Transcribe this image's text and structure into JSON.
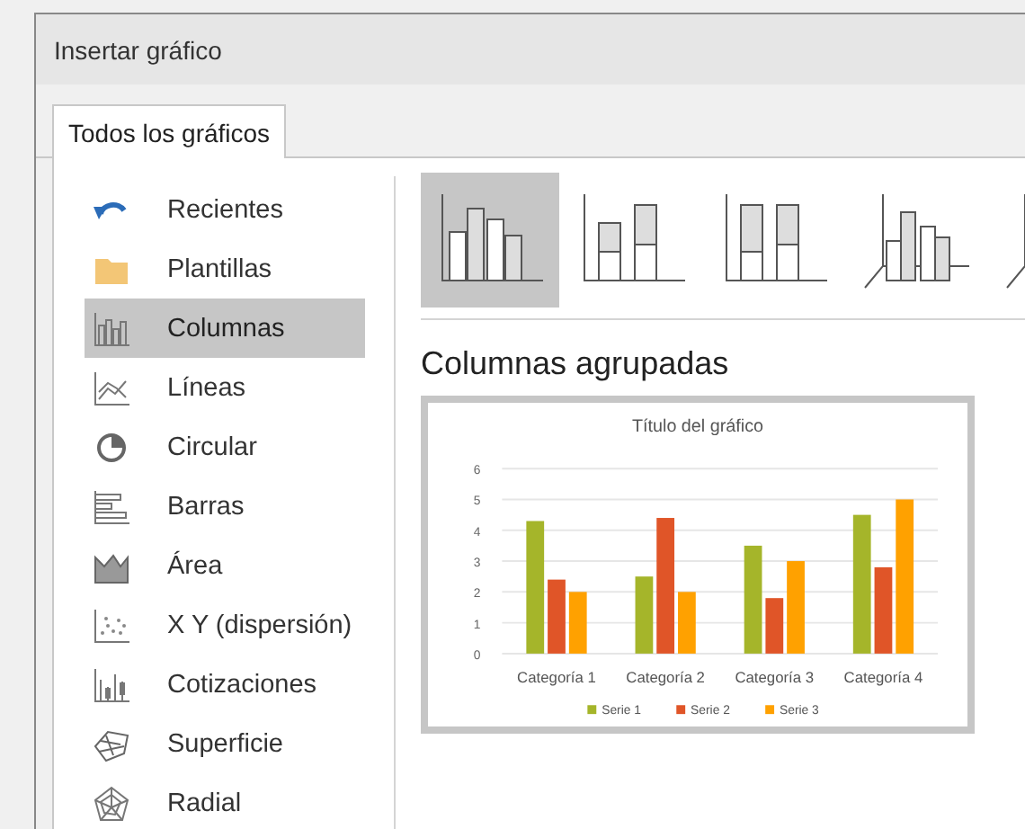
{
  "window": {
    "title": "Insertar gráfico"
  },
  "tabs": [
    {
      "label": "Todos los gráficos",
      "selected": true
    }
  ],
  "sidebar": {
    "items": [
      {
        "label": "Recientes",
        "selected": false
      },
      {
        "label": "Plantillas",
        "selected": false
      },
      {
        "label": "Columnas",
        "selected": true
      },
      {
        "label": "Líneas",
        "selected": false
      },
      {
        "label": "Circular",
        "selected": false
      },
      {
        "label": "Barras",
        "selected": false
      },
      {
        "label": "Área",
        "selected": false
      },
      {
        "label": "X Y (dispersión)",
        "selected": false
      },
      {
        "label": "Cotizaciones",
        "selected": false
      },
      {
        "label": "Superficie",
        "selected": false
      },
      {
        "label": "Radial",
        "selected": false
      }
    ]
  },
  "subtypes": [
    {
      "selected": true
    },
    {
      "selected": false
    },
    {
      "selected": false
    },
    {
      "selected": false
    },
    {
      "selected": false
    }
  ],
  "preview": {
    "heading": "Columnas agrupadas",
    "chart_data": {
      "type": "bar",
      "title": "Título del gráfico",
      "categories": [
        "Categoría 1",
        "Categoría 2",
        "Categoría 3",
        "Categoría 4"
      ],
      "ylim": [
        0,
        6
      ],
      "grid": true,
      "legend": true,
      "yticks": [
        0,
        1,
        2,
        3,
        4,
        5,
        6
      ],
      "series": [
        {
          "name": "Serie 1",
          "color": "#a5b52a",
          "values": [
            4.3,
            2.5,
            3.5,
            4.5
          ]
        },
        {
          "name": "Serie 2",
          "color": "#e05528",
          "values": [
            2.4,
            4.4,
            1.8,
            2.8
          ]
        },
        {
          "name": "Serie 3",
          "color": "#ffa100",
          "values": [
            2,
            2,
            3,
            5
          ]
        }
      ]
    }
  }
}
